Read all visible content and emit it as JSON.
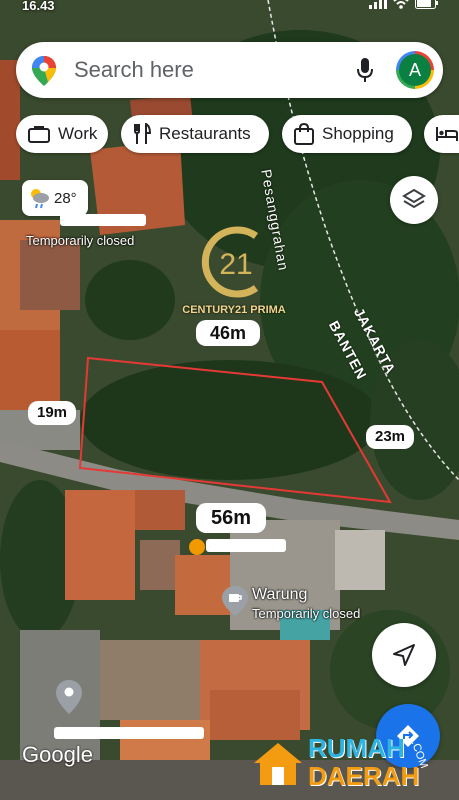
{
  "status_bar": {
    "time": "16.43"
  },
  "search": {
    "placeholder": "Search here",
    "avatar_letter": "A"
  },
  "chips": [
    {
      "label": "Work",
      "icon": "briefcase-icon"
    },
    {
      "label": "Restaurants",
      "icon": "fork-knife-icon"
    },
    {
      "label": "Shopping",
      "icon": "shopping-bag-icon"
    },
    {
      "label": "",
      "icon": "hotel-bed-icon"
    }
  ],
  "weather": {
    "temperature": "28°",
    "icon": "partly-cloudy-rain-icon"
  },
  "map": {
    "poi_top": {
      "status": "Temporarily closed"
    },
    "poi_warung": {
      "name": "Warung",
      "status": "Temporarily closed",
      "icon": "cafe-icon"
    },
    "poi_bottom": {
      "icon": "location-pin-icon"
    },
    "road_label": "Pesanggrahan",
    "border_label_1": "JAKARTA",
    "border_label_2": "BANTEN"
  },
  "overlay": {
    "brand_number": "21",
    "brand_name": "CENTURY21 PRIMA",
    "measure_top": "46m",
    "measure_left": "19m",
    "measure_right": "23m",
    "measure_bottom": "56m"
  },
  "attribution": "Google",
  "watermark": {
    "line1": "RUMAH",
    "line2": "DAERAH",
    "suffix": ".COM"
  },
  "colors": {
    "plot_outline": "#e53935",
    "accent_blue": "#1a73e8",
    "c21_gold": "#d4b45a"
  }
}
